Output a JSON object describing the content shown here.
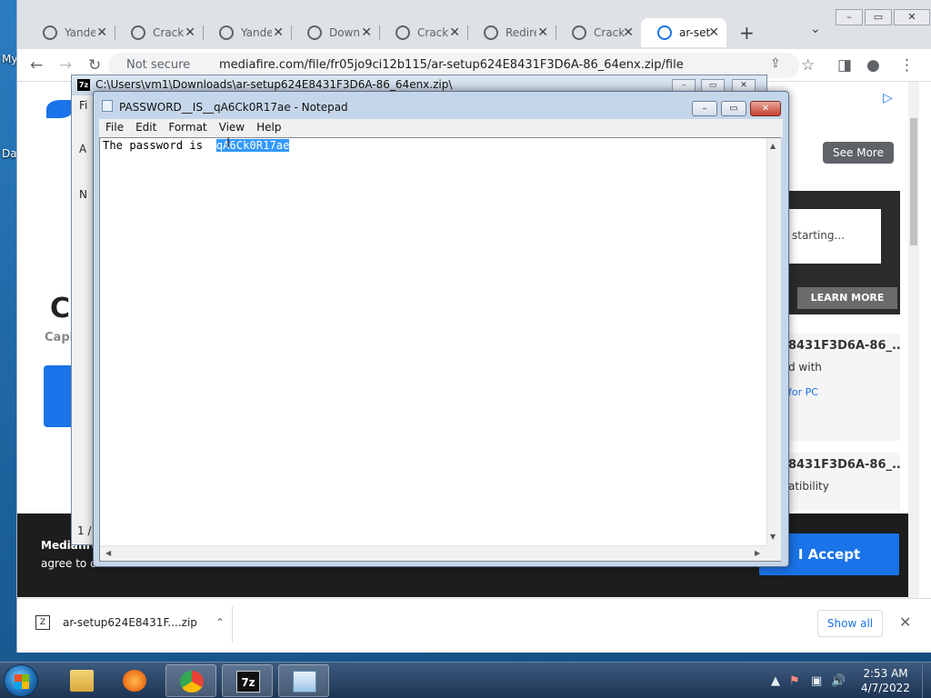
{
  "desktop": {
    "labels": [
      "My",
      "Da"
    ]
  },
  "browser": {
    "tabs": [
      {
        "label": "Yandex",
        "icon": "wordpress-icon"
      },
      {
        "label": "Crack",
        "icon": "globe-icon"
      },
      {
        "label": "Yandex",
        "icon": "globe-icon"
      },
      {
        "label": "Download",
        "icon": "globe-icon"
      },
      {
        "label": "Crack",
        "icon": "globe-icon"
      },
      {
        "label": "Redirect",
        "icon": "globe-icon"
      },
      {
        "label": "Crack",
        "icon": "globe-icon"
      },
      {
        "label": "ar-setup",
        "icon": "mediafire-icon"
      }
    ],
    "new_tab": "+",
    "tab_menu": "⌄",
    "window_buttons": {
      "minimize": "–",
      "maximize": "▭",
      "close": "✕"
    },
    "nav": {
      "back": "←",
      "forward": "→",
      "reload": "↻"
    },
    "address": {
      "security_label": "Not secure",
      "url": "mediafire.com/file/fr05jo9ci12b115/ar-setup624E8431F3D6A-86_64enx.zip/file"
    },
    "toolbar_icons": {
      "share": "⇪",
      "bookmark": "☆",
      "sidepanel": "◨",
      "profile": "●",
      "menu": "⋮"
    }
  },
  "webpage": {
    "ad_info": "▷",
    "see_more": "See More",
    "starting_text": "starting...",
    "learn_more": "LEARN MORE",
    "cards": [
      {
        "heading": "8431F3D6A-86_...",
        "sub": "d with",
        "link": "for PC"
      },
      {
        "heading": "8431F3D6A-86_...",
        "sub": "atibility",
        "link": ""
      }
    ],
    "left_big": "C",
    "left_cap": "Capi",
    "cookie": {
      "line1": "Mediafire",
      "line2": "agree to c",
      "accept": "I Accept"
    }
  },
  "download_bar": {
    "file_name": "ar-setup624E8431F....zip",
    "chevron": "⌃",
    "show_all": "Show all",
    "close": "✕"
  },
  "sevenzip": {
    "title": "C:\\Users\\vm1\\Downloads\\ar-setup624E8431F3D6A-86_64enx.zip\\",
    "logo": "7z",
    "side_labels": [
      "Fi",
      "A",
      "N"
    ],
    "status": "1 /",
    "buttons": {
      "minimize": "–",
      "maximize": "▭",
      "close": "✕"
    }
  },
  "notepad": {
    "title": "PASSWORD__IS__qA6Ck0R17ae - Notepad",
    "menu": [
      "File",
      "Edit",
      "Format",
      "View",
      "Help"
    ],
    "text_prefix": "The password is  ",
    "text_selected": "qA6Ck0R17ae",
    "buttons": {
      "minimize": "–",
      "maximize": "▭",
      "close": "✕"
    },
    "cursor": "I"
  },
  "taskbar": {
    "clock_time": "2:53 AM",
    "clock_date": "4/7/2022",
    "apps": [
      "explorer",
      "media-player",
      "chrome",
      "7zip",
      "notepad"
    ],
    "tray_icons": [
      "▲",
      "⚑",
      "▣",
      "🔊"
    ]
  }
}
